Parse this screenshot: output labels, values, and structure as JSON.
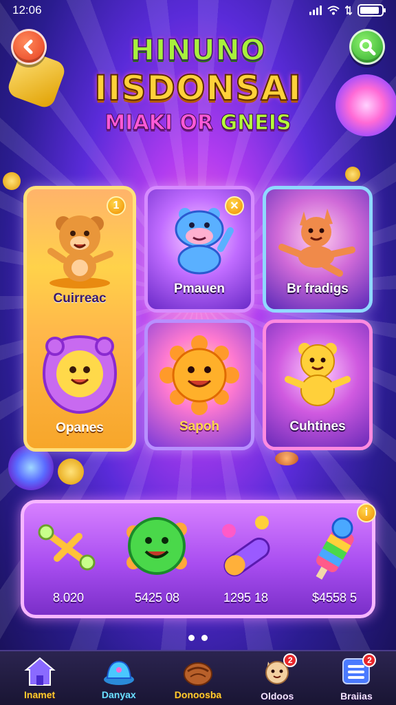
{
  "status_bar": {
    "time": "12:06"
  },
  "header": {
    "title_line1": "HINUNO",
    "title_line2": "IISDONSAI",
    "subtitle_part1": "MIAKI OR ",
    "subtitle_part2": "GNEIS"
  },
  "cards": [
    {
      "label": "Cuirreac",
      "badge": "1"
    },
    {
      "label": "Pmauen"
    },
    {
      "label": "Br fradigs"
    },
    {
      "label": "Opanes"
    },
    {
      "label": "Sapoh"
    },
    {
      "label": "Cuhtines"
    }
  ],
  "shop": {
    "items": [
      {
        "price": "8.020",
        "icon": "golden-wand-icon"
      },
      {
        "price": "5425 08",
        "icon": "green-slime-icon"
      },
      {
        "price": "1295 18",
        "icon": "candy-capsule-icon"
      },
      {
        "price": "$4558 5",
        "icon": "rainbow-pop-icon",
        "badge": "i"
      }
    ]
  },
  "pager": {
    "pages": 2,
    "active": 1
  },
  "bottom_nav": [
    {
      "label": "Inamet",
      "icon": "home-icon"
    },
    {
      "label": "Danyax",
      "icon": "hat-icon"
    },
    {
      "label": "Donoosba",
      "icon": "chestnut-icon"
    },
    {
      "label": "Oldoos",
      "icon": "cat-friend-icon",
      "badge": "2"
    },
    {
      "label": "Braiias",
      "icon": "menu-list-icon",
      "badge": "2"
    }
  ],
  "colors": {
    "title_green": "#a8f03c",
    "title_gold": "#ffd13a",
    "subtitle_pink": "#ff5ad6",
    "card_yellow": "#ffcf3a",
    "card_purple": "#c06cff",
    "card_cyan": "#7fd4ff",
    "card_magenta": "#ff6ad6"
  }
}
